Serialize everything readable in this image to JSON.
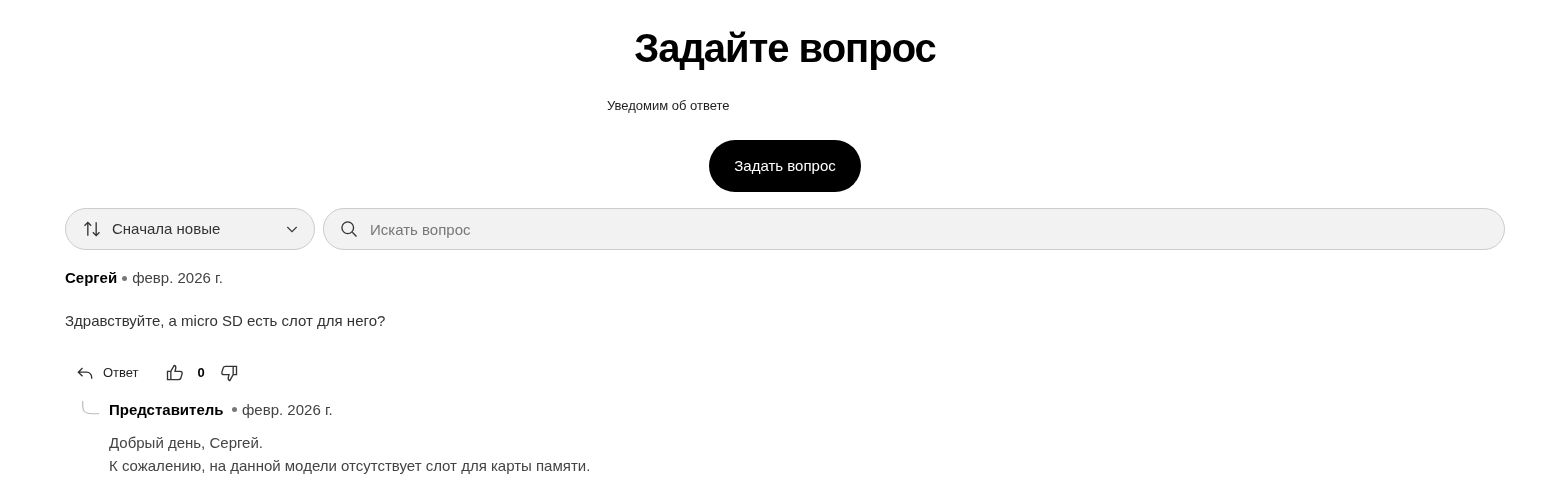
{
  "title": "Задайте вопрос",
  "notice": "Уведомим об ответе",
  "ask_button": "Задать вопрос",
  "sort": {
    "value": "Сначала новые"
  },
  "search": {
    "placeholder": "Искать вопрос"
  },
  "question": {
    "author": "Сергей",
    "date": "февр. 2026 г.",
    "text": "Здравствуйте, а micro SD есть слот для него?",
    "reply_label": "Ответ",
    "likes": "0"
  },
  "answer": {
    "author": "Представитель",
    "date": "февр. 2026 г.",
    "lines": [
      "Добрый день, Сергей.",
      "К сожалению, на данной модели отсутствует слот для карты памяти."
    ]
  }
}
